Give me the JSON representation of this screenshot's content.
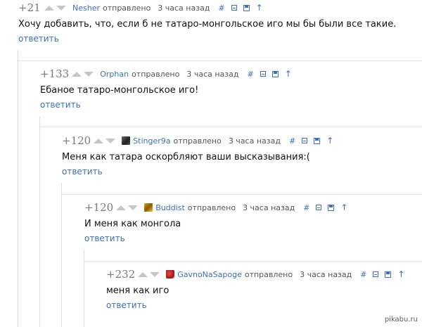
{
  "icons": {
    "up_vote": "triangle-up",
    "down_vote": "triangle-down",
    "link": "hash",
    "collapse": "minus-box",
    "save": "floppy-disk",
    "parent": "arrow-up"
  },
  "colors": {
    "link": "#3c6fbf",
    "rating": "#7a7a7a",
    "text": "#111111",
    "meta": "#555555",
    "arrow": "#c6c6c6"
  },
  "comments": [
    {
      "rating": "+21",
      "author": "Nesher",
      "sent": "отправлено",
      "time": "3 часа назад",
      "text": "Хочу добавить, что, если б не татаро-монгольское иго мы бы были все такие.",
      "reply": "ответить",
      "tools": [
        "#",
        "⊟",
        "💾",
        "↑"
      ]
    },
    {
      "rating": "+133",
      "author": "Orphan",
      "sent": "отправлено",
      "time": "3 часа назад",
      "text": "Ебаное татаро-монгольское иго!",
      "reply": "ответить",
      "tools": [
        "#",
        "⊟",
        "💾",
        "↑"
      ]
    },
    {
      "rating": "+120",
      "author": "Stinger9a",
      "sent": "отправлено",
      "time": "3 часа назад",
      "text": "Меня как татара оскорбляют ваши высказывания:(",
      "reply": "ответить",
      "tools": [
        "#",
        "⊟",
        "💾",
        "↑"
      ]
    },
    {
      "rating": "+120",
      "author": "Buddist",
      "sent": "отправлено",
      "time": "3 часа назад",
      "text": "И меня как монгола",
      "reply": "ответить",
      "tools": [
        "#",
        "⊟",
        "💾",
        "↑"
      ]
    },
    {
      "rating": "+232",
      "author": "GavnoNaSapoge",
      "sent": "отправлено",
      "time": "3 часа назад",
      "text": "меня как иго",
      "reply": "ответить",
      "tools": [
        "#",
        "⊟",
        "💾",
        "↑"
      ]
    }
  ],
  "watermark": "pikabu.ru"
}
